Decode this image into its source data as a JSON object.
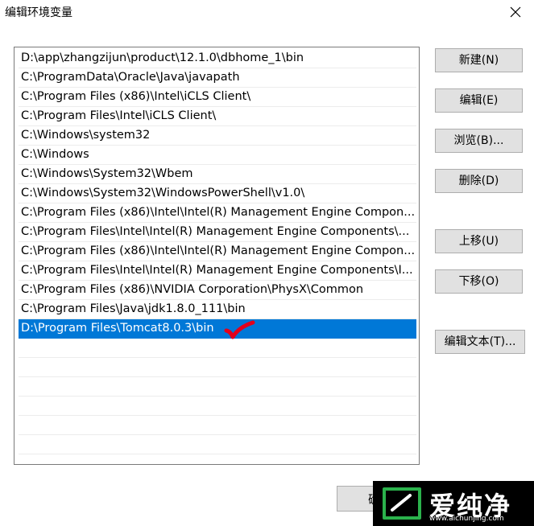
{
  "window": {
    "title": "编辑环境变量"
  },
  "paths": [
    "D:\\app\\zhangzijun\\product\\12.1.0\\dbhome_1\\bin",
    "C:\\ProgramData\\Oracle\\Java\\javapath",
    "C:\\Program Files (x86)\\Intel\\iCLS Client\\",
    "C:\\Program Files\\Intel\\iCLS Client\\",
    "C:\\Windows\\system32",
    "C:\\Windows",
    "C:\\Windows\\System32\\Wbem",
    "C:\\Windows\\System32\\WindowsPowerShell\\v1.0\\",
    "C:\\Program Files (x86)\\Intel\\Intel(R) Management Engine Compon...",
    "C:\\Program Files\\Intel\\Intel(R) Management Engine Components\\...",
    "C:\\Program Files (x86)\\Intel\\Intel(R) Management Engine Compon...",
    "C:\\Program Files\\Intel\\Intel(R) Management Engine Components\\I...",
    "C:\\Program Files (x86)\\NVIDIA Corporation\\PhysX\\Common",
    "C:\\Program Files\\Java\\jdk1.8.0_111\\bin",
    "D:\\Program Files\\Tomcat8.0.3\\bin"
  ],
  "selected_index": 14,
  "buttons": {
    "new": "新建(N)",
    "edit": "编辑(E)",
    "browse": "浏览(B)...",
    "delete": "删除(D)",
    "move_up": "上移(U)",
    "move_down": "下移(O)",
    "edit_text": "编辑文本(T)...",
    "ok_partial": "确"
  },
  "watermark": {
    "brand": "爱纯净",
    "url": "www.aichunjing.com"
  },
  "colors": {
    "selection": "#0078d7",
    "annotation_check": "#e3001b"
  }
}
